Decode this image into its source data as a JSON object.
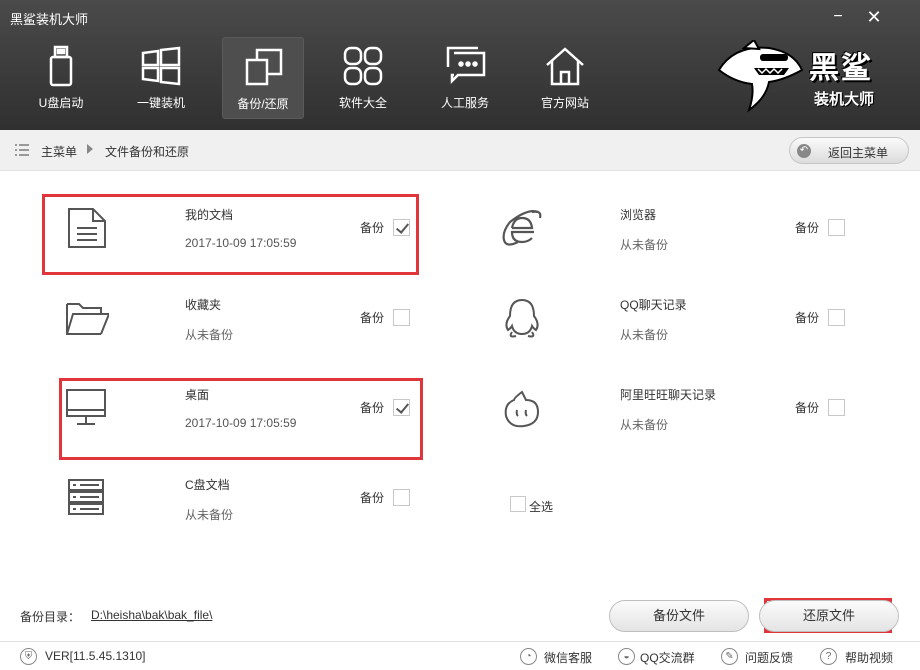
{
  "window": {
    "title": "黑鲨装机大师",
    "minimize": "−",
    "close": "✕"
  },
  "nav": [
    {
      "label": "U盘启动",
      "icon": "usb-drive-icon"
    },
    {
      "label": "一键装机",
      "icon": "windows-icon"
    },
    {
      "label": "备份/还原",
      "icon": "backup-restore-icon",
      "active": true
    },
    {
      "label": "软件大全",
      "icon": "apps-grid-icon"
    },
    {
      "label": "人工服务",
      "icon": "chat-bubble-icon"
    },
    {
      "label": "官方网站",
      "icon": "home-icon"
    }
  ],
  "logo": {
    "text": "黑鲨",
    "subtext": "装机大师",
    "icon": "shark-logo-icon"
  },
  "breadcrumb": {
    "home": "主菜单",
    "current": "文件备份和还原",
    "back_button": "返回主菜单"
  },
  "items": [
    {
      "name": "我的文档",
      "status": "2017-10-09 17:05:59",
      "backup_label": "备份",
      "checked": true,
      "icon": "document-icon"
    },
    {
      "name": "浏览器",
      "status": "从未备份",
      "backup_label": "备份",
      "checked": false,
      "icon": "ie-browser-icon"
    },
    {
      "name": "收藏夹",
      "status": "从未备份",
      "backup_label": "备份",
      "checked": false,
      "icon": "folder-icon"
    },
    {
      "name": "QQ聊天记录",
      "status": "从未备份",
      "backup_label": "备份",
      "checked": false,
      "icon": "qq-penguin-icon"
    },
    {
      "name": "桌面",
      "status": "2017-10-09 17:05:59",
      "backup_label": "备份",
      "checked": true,
      "icon": "monitor-icon"
    },
    {
      "name": "阿里旺旺聊天记录",
      "status": "从未备份",
      "backup_label": "备份",
      "checked": false,
      "icon": "aliwangwang-icon"
    },
    {
      "name": "C盘文档",
      "status": "从未备份",
      "backup_label": "备份",
      "checked": false,
      "icon": "server-drive-icon"
    }
  ],
  "select_all": "全选",
  "footer": {
    "dir_label": "备份目录：",
    "dir_path": "D:\\heisha\\bak\\bak_file\\",
    "backup_button": "备份文件",
    "restore_button": "还原文件"
  },
  "statusbar": {
    "version": "VER[11.5.45.1310]",
    "links": [
      {
        "label": "微信客服",
        "icon": "wechat-icon"
      },
      {
        "label": "QQ交流群",
        "icon": "qq-icon"
      },
      {
        "label": "问题反馈",
        "icon": "feedback-icon"
      },
      {
        "label": "帮助视频",
        "icon": "help-icon"
      }
    ]
  },
  "colors": {
    "header_bg": "#3c3c3c",
    "highlight_border": "#e0363b"
  }
}
